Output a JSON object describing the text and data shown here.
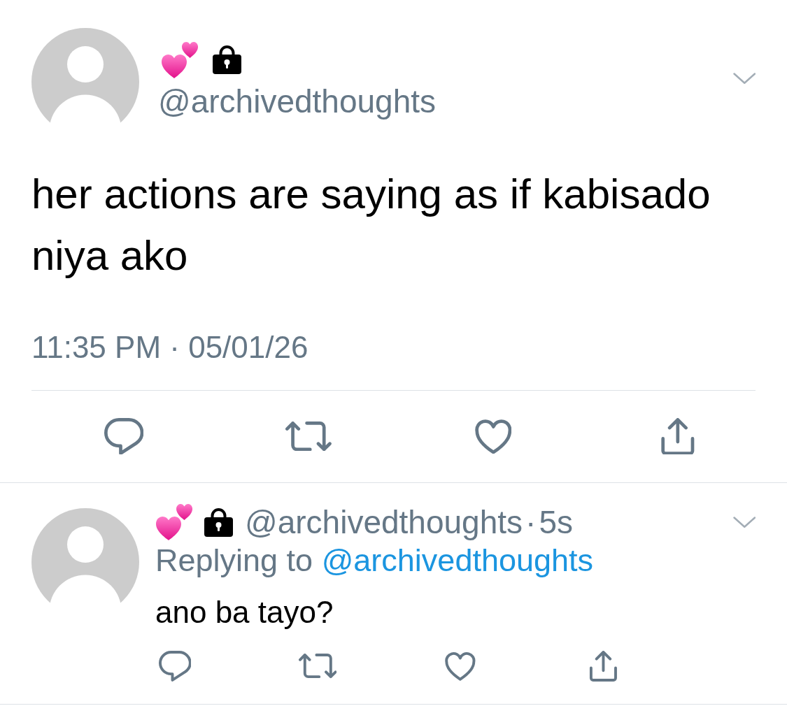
{
  "tweet": {
    "author": {
      "protected": true,
      "handle": "@archivedthoughts"
    },
    "text": "her actions are saying as if kabisado niya ako",
    "timestamp": "11:35 PM · 05/01/26",
    "actions": [
      {
        "kind": "reply"
      },
      {
        "kind": "retweet"
      },
      {
        "kind": "like"
      },
      {
        "kind": "share"
      }
    ]
  },
  "reply": {
    "author": {
      "protected": true,
      "handle": "@archivedthoughts"
    },
    "separator": "·",
    "time": "5s",
    "replying_to": {
      "label": "Replying to",
      "handle": "@archivedthoughts"
    },
    "text": "ano ba tayo?",
    "actions": [
      {
        "kind": "reply"
      },
      {
        "kind": "retweet"
      },
      {
        "kind": "like"
      },
      {
        "kind": "share"
      }
    ]
  }
}
